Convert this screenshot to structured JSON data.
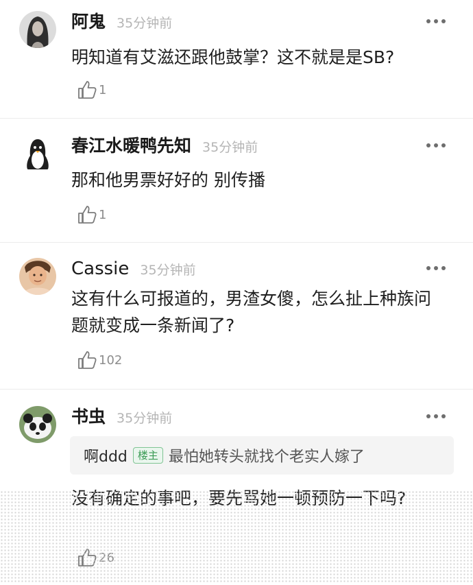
{
  "comments": [
    {
      "user": "阿鬼",
      "time": "35分钟前",
      "text": "明知道有艾滋还跟他鼓掌？这不就是是SB?",
      "likes": "1",
      "avatar": "portrait-dark-hair"
    },
    {
      "user": "春江水暖鸭先知",
      "time": "35分钟前",
      "text": "那和他男票好好的 别传播",
      "likes": "1",
      "avatar": "penguin"
    },
    {
      "user": "Cassie",
      "time": "35分钟前",
      "text": "这有什么可报道的，男渣女傻，怎么扯上种族问题就变成一条新闻了?",
      "likes": "102",
      "avatar": "photo-person"
    },
    {
      "user": "书虫",
      "time": "35分钟前",
      "quote": {
        "name": "啊ddd",
        "badge": "楼主",
        "text": "最怕她转头就找个老实人嫁了"
      },
      "text": "没有确定的事吧，要先骂她一顿预防一下吗?",
      "likes": "26",
      "avatar": "panda"
    }
  ],
  "icons": {
    "more": "more-dots-icon",
    "like": "thumbs-up-icon"
  },
  "colors": {
    "username": "#1a1a1a",
    "time": "#b5b5b5",
    "meta": "#8d8d8d",
    "badge_green": "#3a9a54",
    "quote_bg": "#f4f4f4"
  }
}
